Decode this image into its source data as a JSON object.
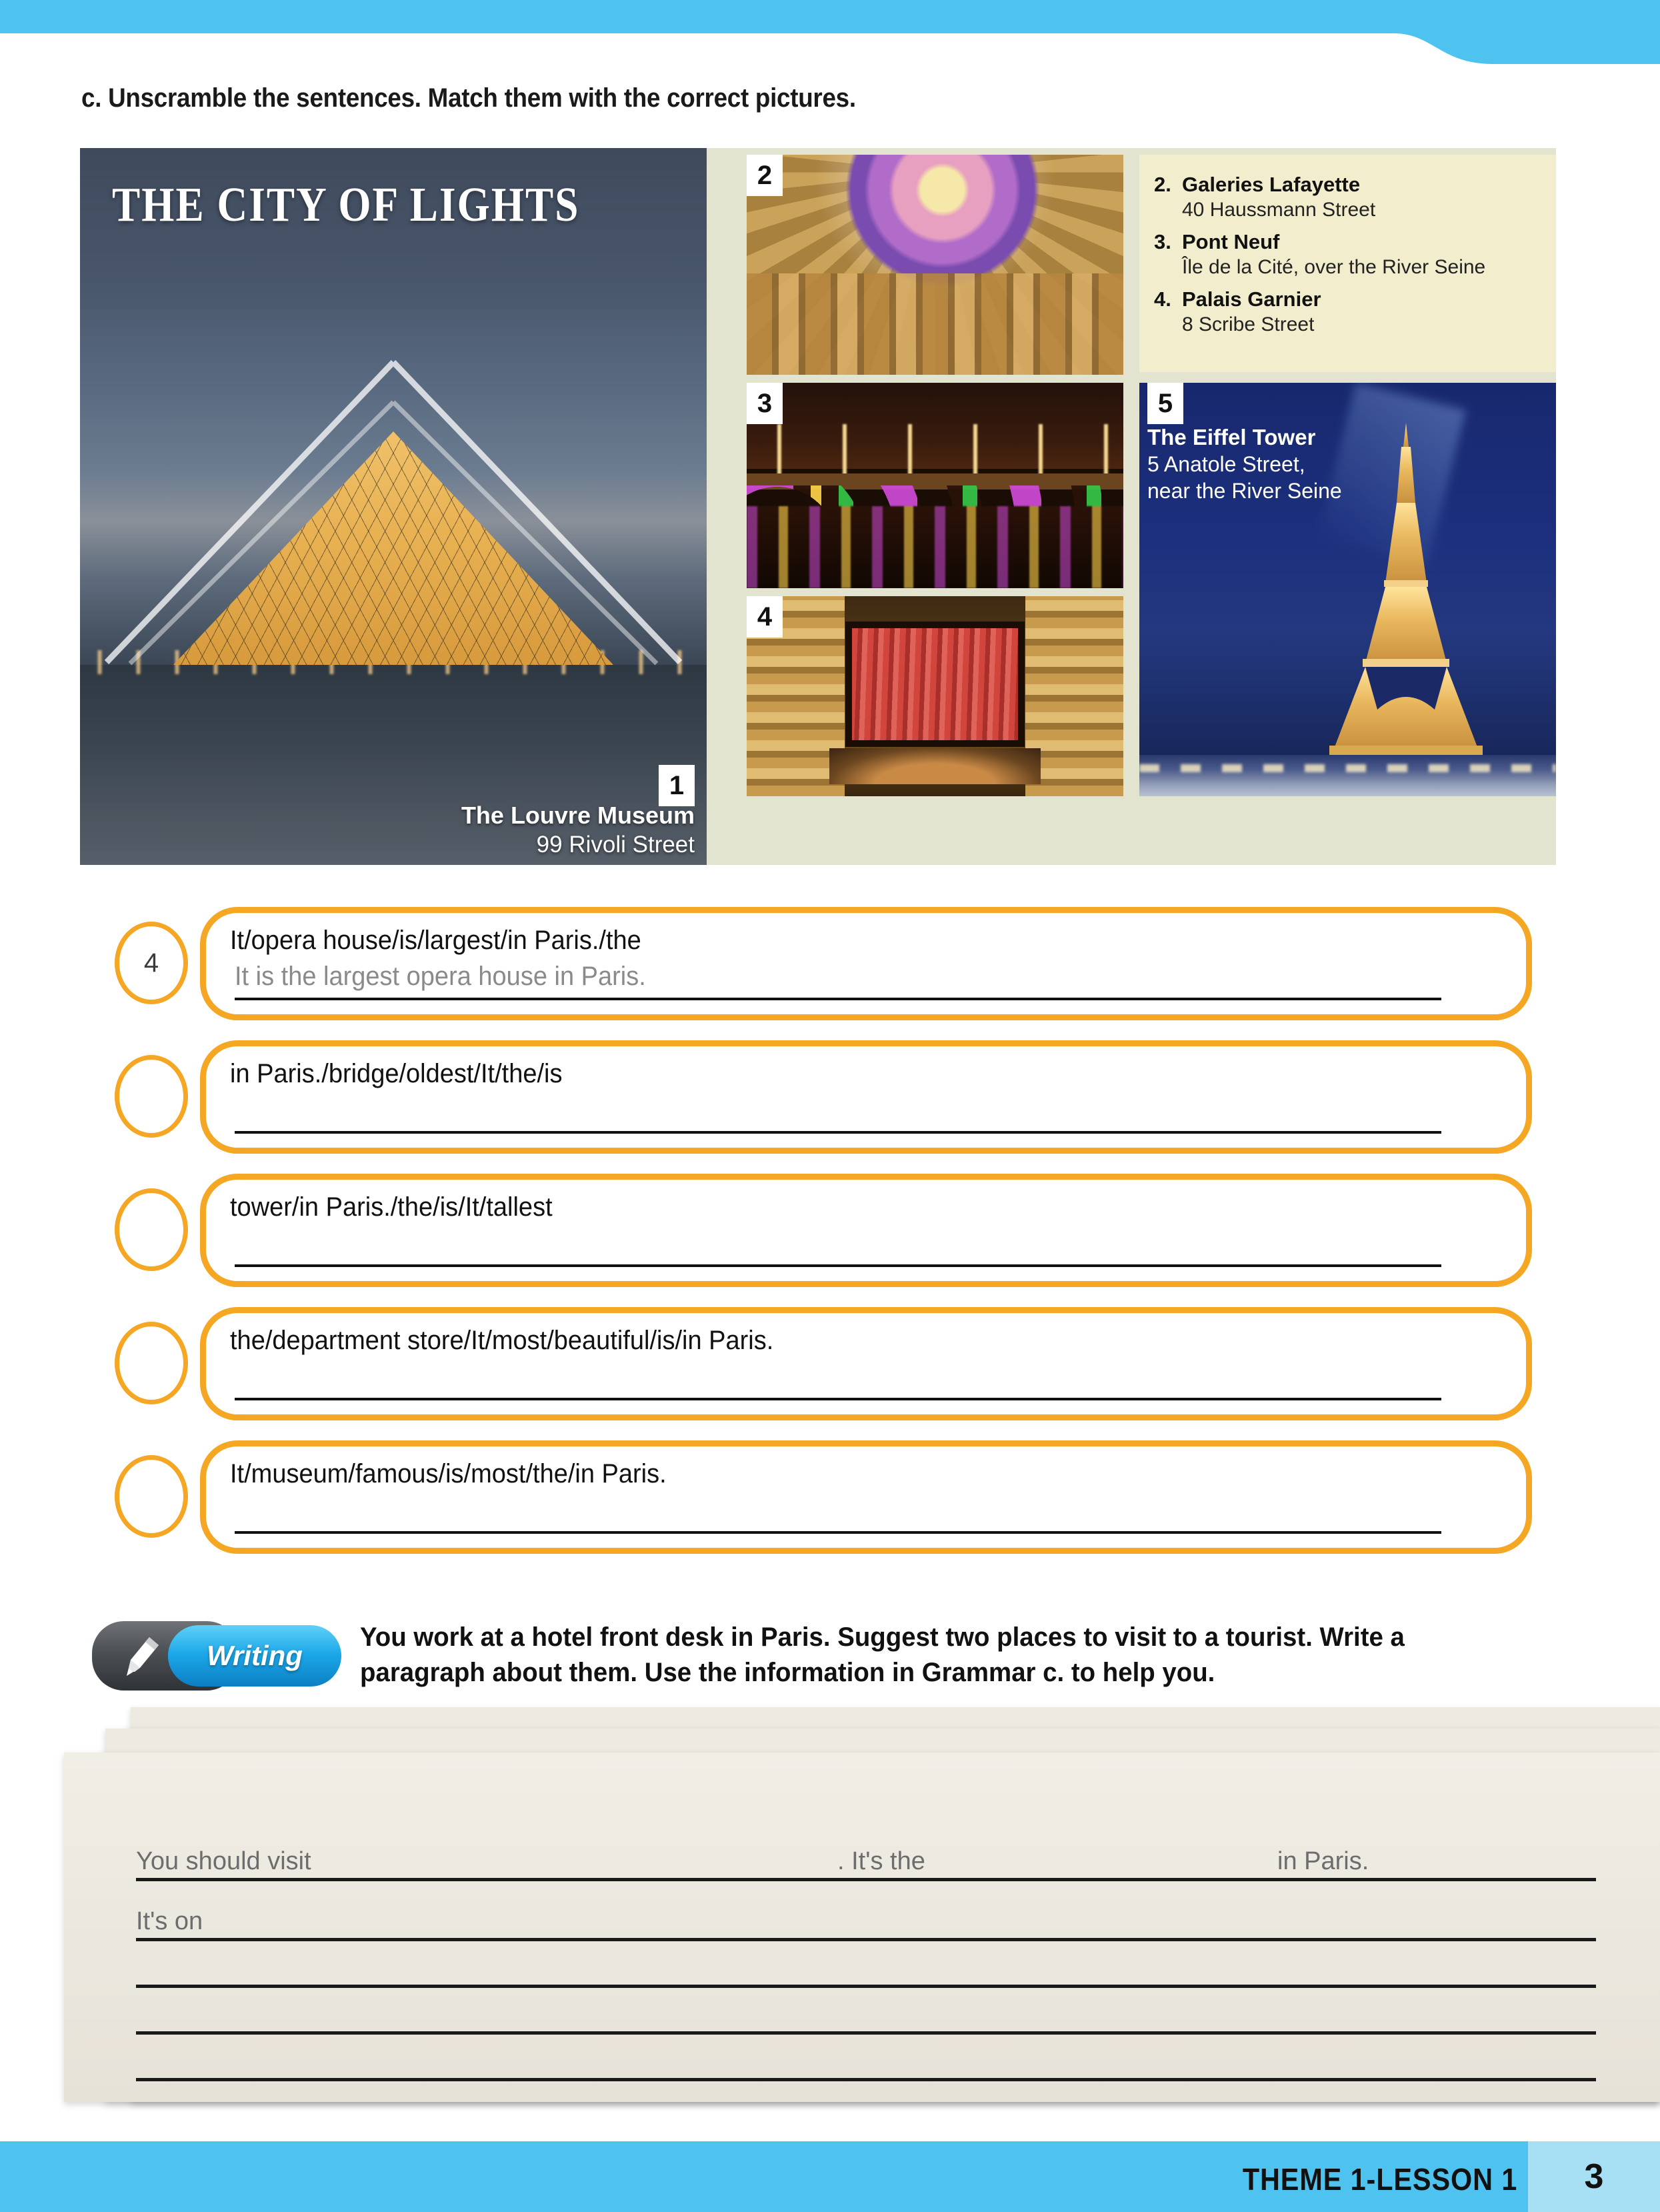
{
  "page": {
    "heading": "c. Unscramble the sentences. Match them with the correct pictures."
  },
  "collage": {
    "poster_title": "THE CITY OF LIGHTS",
    "louvre": {
      "badge": "1",
      "name": "The Louvre Museum",
      "address": "99 Rivoli Street"
    },
    "lafayette": {
      "badge": "2"
    },
    "pont_neuf": {
      "badge": "3"
    },
    "opera": {
      "badge": "4"
    },
    "eiffel": {
      "badge": "5",
      "name": "The Eiffel Tower",
      "address_line1": "5 Anatole Street,",
      "address_line2": "near the River Seine"
    },
    "info_list": [
      {
        "num": "2.",
        "name": "Galeries Lafayette",
        "address": "40 Haussmann Street"
      },
      {
        "num": "3.",
        "name": "Pont Neuf",
        "address": "Île de la Cité, over the River Seine"
      },
      {
        "num": "4.",
        "name": "Palais Garnier",
        "address": "8 Scribe Street"
      }
    ]
  },
  "exercises": [
    {
      "circle": "4",
      "scramble": "It/opera house/is/largest/in Paris./the",
      "answer": "It is the largest opera house in Paris."
    },
    {
      "circle": "",
      "scramble": "in Paris./bridge/oldest/It/the/is",
      "answer": ""
    },
    {
      "circle": "",
      "scramble": "tower/in Paris./the/is/It/tallest",
      "answer": ""
    },
    {
      "circle": "",
      "scramble": "the/department store/It/most/beautiful/is/in Paris.",
      "answer": ""
    },
    {
      "circle": "",
      "scramble": "It/museum/famous/is/most/the/in Paris.",
      "answer": ""
    }
  ],
  "writing": {
    "badge_label": "Writing",
    "instruction": "You work at a hotel front desk in Paris. Suggest two places to visit to a tourist. Write a paragraph about them. Use the information in Grammar c. to help you.",
    "prompt_1": "You should visit",
    "prompt_2": ". It's the",
    "prompt_3": "in Paris.",
    "prompt_4": "It's on"
  },
  "footer": {
    "theme": "THEME 1-LESSON 1",
    "page_number": "3"
  },
  "colors": {
    "cyan": "#4ec3ef",
    "orange": "#f5a623",
    "paper": "#edeae1",
    "collage_bg": "#e3e4cf",
    "info_bg": "#f2eecd"
  }
}
